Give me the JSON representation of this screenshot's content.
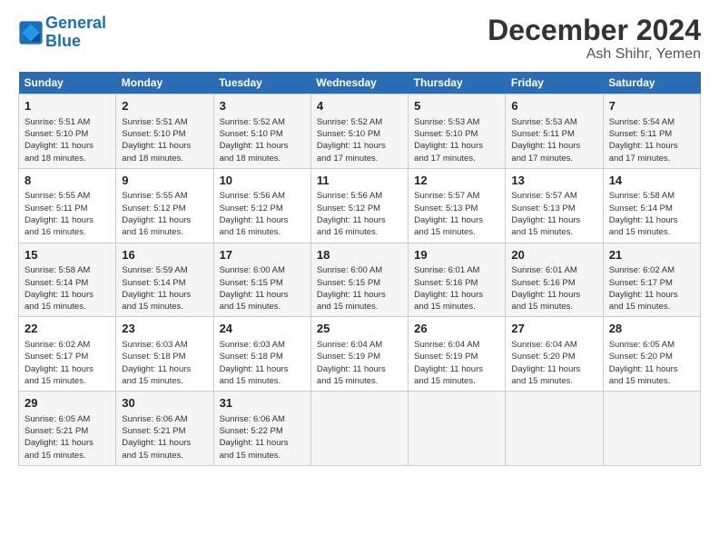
{
  "logo": {
    "line1": "General",
    "line2": "Blue"
  },
  "title": "December 2024",
  "location": "Ash Shihr, Yemen",
  "days_of_week": [
    "Sunday",
    "Monday",
    "Tuesday",
    "Wednesday",
    "Thursday",
    "Friday",
    "Saturday"
  ],
  "weeks": [
    [
      {
        "day": "1",
        "info": "Sunrise: 5:51 AM\nSunset: 5:10 PM\nDaylight: 11 hours\nand 18 minutes."
      },
      {
        "day": "2",
        "info": "Sunrise: 5:51 AM\nSunset: 5:10 PM\nDaylight: 11 hours\nand 18 minutes."
      },
      {
        "day": "3",
        "info": "Sunrise: 5:52 AM\nSunset: 5:10 PM\nDaylight: 11 hours\nand 18 minutes."
      },
      {
        "day": "4",
        "info": "Sunrise: 5:52 AM\nSunset: 5:10 PM\nDaylight: 11 hours\nand 17 minutes."
      },
      {
        "day": "5",
        "info": "Sunrise: 5:53 AM\nSunset: 5:10 PM\nDaylight: 11 hours\nand 17 minutes."
      },
      {
        "day": "6",
        "info": "Sunrise: 5:53 AM\nSunset: 5:11 PM\nDaylight: 11 hours\nand 17 minutes."
      },
      {
        "day": "7",
        "info": "Sunrise: 5:54 AM\nSunset: 5:11 PM\nDaylight: 11 hours\nand 17 minutes."
      }
    ],
    [
      {
        "day": "8",
        "info": "Sunrise: 5:55 AM\nSunset: 5:11 PM\nDaylight: 11 hours\nand 16 minutes."
      },
      {
        "day": "9",
        "info": "Sunrise: 5:55 AM\nSunset: 5:12 PM\nDaylight: 11 hours\nand 16 minutes."
      },
      {
        "day": "10",
        "info": "Sunrise: 5:56 AM\nSunset: 5:12 PM\nDaylight: 11 hours\nand 16 minutes."
      },
      {
        "day": "11",
        "info": "Sunrise: 5:56 AM\nSunset: 5:12 PM\nDaylight: 11 hours\nand 16 minutes."
      },
      {
        "day": "12",
        "info": "Sunrise: 5:57 AM\nSunset: 5:13 PM\nDaylight: 11 hours\nand 15 minutes."
      },
      {
        "day": "13",
        "info": "Sunrise: 5:57 AM\nSunset: 5:13 PM\nDaylight: 11 hours\nand 15 minutes."
      },
      {
        "day": "14",
        "info": "Sunrise: 5:58 AM\nSunset: 5:14 PM\nDaylight: 11 hours\nand 15 minutes."
      }
    ],
    [
      {
        "day": "15",
        "info": "Sunrise: 5:58 AM\nSunset: 5:14 PM\nDaylight: 11 hours\nand 15 minutes."
      },
      {
        "day": "16",
        "info": "Sunrise: 5:59 AM\nSunset: 5:14 PM\nDaylight: 11 hours\nand 15 minutes."
      },
      {
        "day": "17",
        "info": "Sunrise: 6:00 AM\nSunset: 5:15 PM\nDaylight: 11 hours\nand 15 minutes."
      },
      {
        "day": "18",
        "info": "Sunrise: 6:00 AM\nSunset: 5:15 PM\nDaylight: 11 hours\nand 15 minutes."
      },
      {
        "day": "19",
        "info": "Sunrise: 6:01 AM\nSunset: 5:16 PM\nDaylight: 11 hours\nand 15 minutes."
      },
      {
        "day": "20",
        "info": "Sunrise: 6:01 AM\nSunset: 5:16 PM\nDaylight: 11 hours\nand 15 minutes."
      },
      {
        "day": "21",
        "info": "Sunrise: 6:02 AM\nSunset: 5:17 PM\nDaylight: 11 hours\nand 15 minutes."
      }
    ],
    [
      {
        "day": "22",
        "info": "Sunrise: 6:02 AM\nSunset: 5:17 PM\nDaylight: 11 hours\nand 15 minutes."
      },
      {
        "day": "23",
        "info": "Sunrise: 6:03 AM\nSunset: 5:18 PM\nDaylight: 11 hours\nand 15 minutes."
      },
      {
        "day": "24",
        "info": "Sunrise: 6:03 AM\nSunset: 5:18 PM\nDaylight: 11 hours\nand 15 minutes."
      },
      {
        "day": "25",
        "info": "Sunrise: 6:04 AM\nSunset: 5:19 PM\nDaylight: 11 hours\nand 15 minutes."
      },
      {
        "day": "26",
        "info": "Sunrise: 6:04 AM\nSunset: 5:19 PM\nDaylight: 11 hours\nand 15 minutes."
      },
      {
        "day": "27",
        "info": "Sunrise: 6:04 AM\nSunset: 5:20 PM\nDaylight: 11 hours\nand 15 minutes."
      },
      {
        "day": "28",
        "info": "Sunrise: 6:05 AM\nSunset: 5:20 PM\nDaylight: 11 hours\nand 15 minutes."
      }
    ],
    [
      {
        "day": "29",
        "info": "Sunrise: 6:05 AM\nSunset: 5:21 PM\nDaylight: 11 hours\nand 15 minutes."
      },
      {
        "day": "30",
        "info": "Sunrise: 6:06 AM\nSunset: 5:21 PM\nDaylight: 11 hours\nand 15 minutes."
      },
      {
        "day": "31",
        "info": "Sunrise: 6:06 AM\nSunset: 5:22 PM\nDaylight: 11 hours\nand 15 minutes."
      },
      {
        "day": "",
        "info": ""
      },
      {
        "day": "",
        "info": ""
      },
      {
        "day": "",
        "info": ""
      },
      {
        "day": "",
        "info": ""
      }
    ]
  ]
}
